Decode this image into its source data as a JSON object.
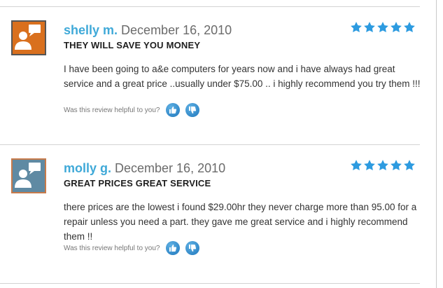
{
  "reviews": [
    {
      "author": "shelly m.",
      "date": "December 16, 2010",
      "title": "THEY WILL SAVE YOU MONEY",
      "body": "I have been going to a&e computers for years now and i have always had great service and a great price ..usually under $75.00 .. i highly recommend you try them !!!",
      "helpful_prompt": "Was this review helpful to you?",
      "rating": 5,
      "avatar_color": "#d9701e",
      "avatar_icon": "user-speech-bubble-icon"
    },
    {
      "author": "molly g.",
      "date": "December 16, 2010",
      "title": "GREAT PRICES GREAT SERVICE",
      "body": "there prices are the lowest i found $29.00hr they never charge more than 95.00 for a repair unless you need a part. they gave me great service and i highly recommend them !!",
      "helpful_prompt": "Was this review helpful to you?",
      "rating": 5,
      "avatar_color": "#5f8aa3",
      "avatar_icon": "user-speech-bubble-icon"
    }
  ],
  "colors": {
    "author": "#3fa9d8",
    "star": "#2d9be0",
    "vote_button": "#1f78bd"
  }
}
